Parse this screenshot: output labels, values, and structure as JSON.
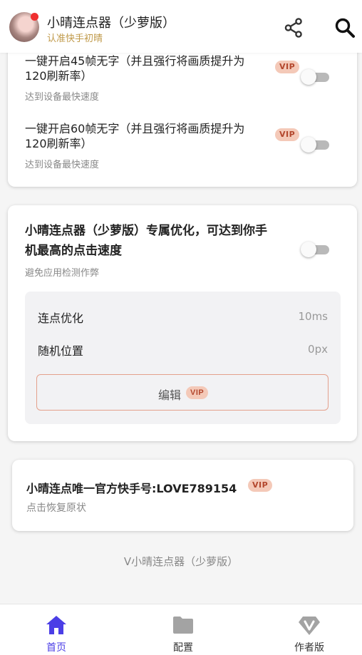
{
  "header": {
    "title": "小晴连点器（少萝版）",
    "subtitle": "认准快手初晴",
    "icons": {
      "share": "share-icon",
      "search": "search-icon"
    }
  },
  "vip_badge": "VIP",
  "options": [
    {
      "title_line1": "一键开启45帧无字（并且强行将画质提升为",
      "title_line2": "120刷新率）",
      "subtitle": "达到设备最快速度",
      "enabled": false
    },
    {
      "title_line1": "一键开启60帧无字（并且强行将画质提升为",
      "title_line2": "120刷新率）",
      "subtitle": "达到设备最快速度",
      "enabled": false
    }
  ],
  "optimization": {
    "title_line1": "小晴连点器（少萝版）专属优化，可达到你手",
    "title_line2": "机最高的点击速度",
    "subtitle": "避免应用检测作弊",
    "enabled": false,
    "rows": [
      {
        "label": "连点优化",
        "value": "10ms"
      },
      {
        "label": "随机位置",
        "value": "0px"
      }
    ],
    "edit_label": "编辑"
  },
  "official": {
    "title": "小晴连点唯一官方快手号:LOVE789154",
    "subtitle": "点击恢复原状"
  },
  "footer_note": "V小晴连点器（少萝版）",
  "nav": [
    {
      "label": "首页",
      "icon": "home-icon",
      "active": true
    },
    {
      "label": "配置",
      "icon": "folder-icon",
      "active": false
    },
    {
      "label": "作者版",
      "icon": "diamond-v-icon",
      "active": false
    }
  ],
  "colors": {
    "accent": "#4b3ee6",
    "vip_bg": "#f4c9b8",
    "vip_text": "#b3472d",
    "nav_inactive": "#a3a3a3"
  }
}
